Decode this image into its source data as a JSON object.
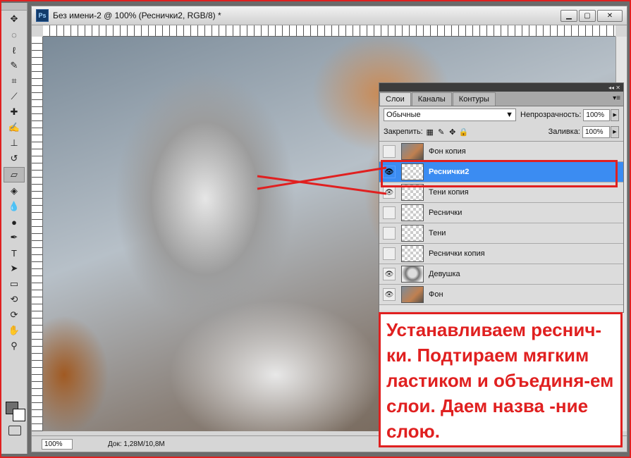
{
  "document": {
    "title": "Без имени-2 @ 100% (Реснички2, RGB/8) *",
    "app_icon": "Ps",
    "zoom": "100%",
    "doc_info": "Док: 1,28M/10,8M"
  },
  "window_controls": {
    "minimize": "▁",
    "maximize": "▢",
    "close": "✕"
  },
  "tools": [
    "move-icon",
    "marquee-icon",
    "lasso-icon",
    "quick-select-icon",
    "crop-icon",
    "eyedropper-icon",
    "healing-icon",
    "brush-icon",
    "stamp-icon",
    "history-brush-icon",
    "eraser-icon",
    "bucket-icon",
    "blur-icon",
    "dodge-icon",
    "pen-icon",
    "type-icon",
    "path-select-icon",
    "shape-icon",
    "3d-rotate-icon",
    "3d-orbit-icon",
    "hand-icon",
    "zoom-icon"
  ],
  "layers_panel": {
    "tabs": [
      "Слои",
      "Каналы",
      "Контуры"
    ],
    "blend_mode": "Обычные",
    "opacity_label": "Непрозрачность:",
    "opacity_value": "100%",
    "lock_label": "Закрепить:",
    "fill_label": "Заливка:",
    "fill_value": "100%",
    "layers": [
      {
        "name": "Фон копия",
        "visible": false,
        "thumb": "photo"
      },
      {
        "name": "Реснички2",
        "visible": true,
        "thumb": "transparent",
        "selected": true
      },
      {
        "name": "Тени копия",
        "visible": true,
        "thumb": "transparent"
      },
      {
        "name": "Реснички",
        "visible": false,
        "thumb": "transparent"
      },
      {
        "name": "Тени",
        "visible": false,
        "thumb": "transparent"
      },
      {
        "name": "Реснички копия",
        "visible": false,
        "thumb": "transparent"
      },
      {
        "name": "Девушка",
        "visible": true,
        "thumb": "girl"
      },
      {
        "name": "Фон",
        "visible": true,
        "thumb": "photo"
      }
    ]
  },
  "callout": {
    "text": "Устанавливаем реснич-ки. Подтираем мягким ластиком и объединя-ем слои. Даем назва -ние слою."
  },
  "colors": {
    "annotation": "#e02020",
    "selection": "#3b8cf2"
  }
}
